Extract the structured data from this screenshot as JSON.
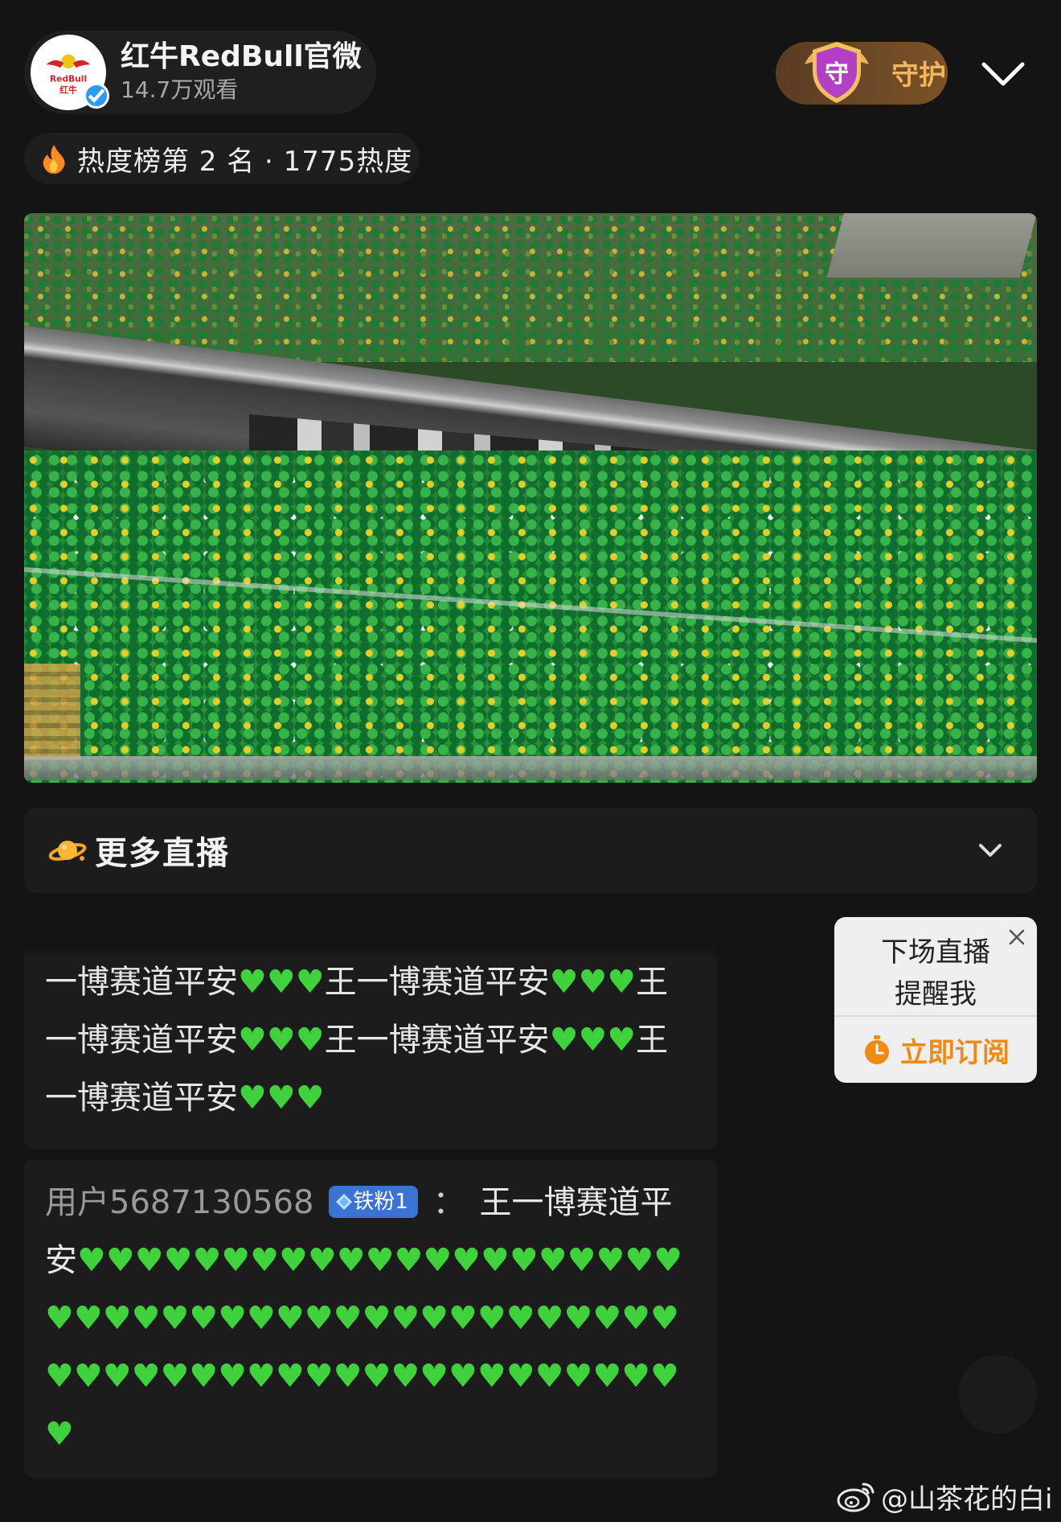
{
  "host": {
    "name": "红牛RedBull官微",
    "views": "14.7万观看",
    "avatar_logo_text": "RedBull 红牛"
  },
  "guard": {
    "badge_char": "守",
    "label": "守护"
  },
  "heat": {
    "text": "热度榜第 2 名 · 1775热度"
  },
  "more_live": {
    "label": "更多直播"
  },
  "comments": [
    {
      "user": "",
      "badge": "",
      "text": "一博赛道平安💚💚💚王一博赛道平安💚💚💚王一博赛道平安💚💚💚王一博赛道平安💚💚💚王一博赛道平安💚💚💚"
    },
    {
      "user": "用户5687130568",
      "badge": "铁粉1",
      "separator": "：",
      "text": "王一博赛道平安💚💚💚💚💚💚💚💚💚💚💚💚💚💚💚💚💚💚💚💚💚💚💚💚💚💚💚💚💚💚💚💚💚💚💚💚💚💚💚💚💚💚💚💚💚💚💚💚💚💚💚💚💚💚💚💚💚💚💚💚💚💚💚💚💚💚"
    }
  ],
  "reminder": {
    "title_line1": "下场直播",
    "title_line2": "提醒我",
    "action": "立即订阅"
  },
  "watermark": {
    "text": "@山茶花的白i"
  },
  "colors": {
    "background": "#141414",
    "heart_green": "#3fd23c",
    "guard_gold": "#f2b75a",
    "subscribe_orange": "#f08a12",
    "fan_badge_blue": "#3a73d4"
  },
  "icons": [
    "flame-icon",
    "planet-icon",
    "chevron-down-icon",
    "close-icon",
    "clock-icon",
    "weibo-icon",
    "verified-icon",
    "shield-icon"
  ]
}
